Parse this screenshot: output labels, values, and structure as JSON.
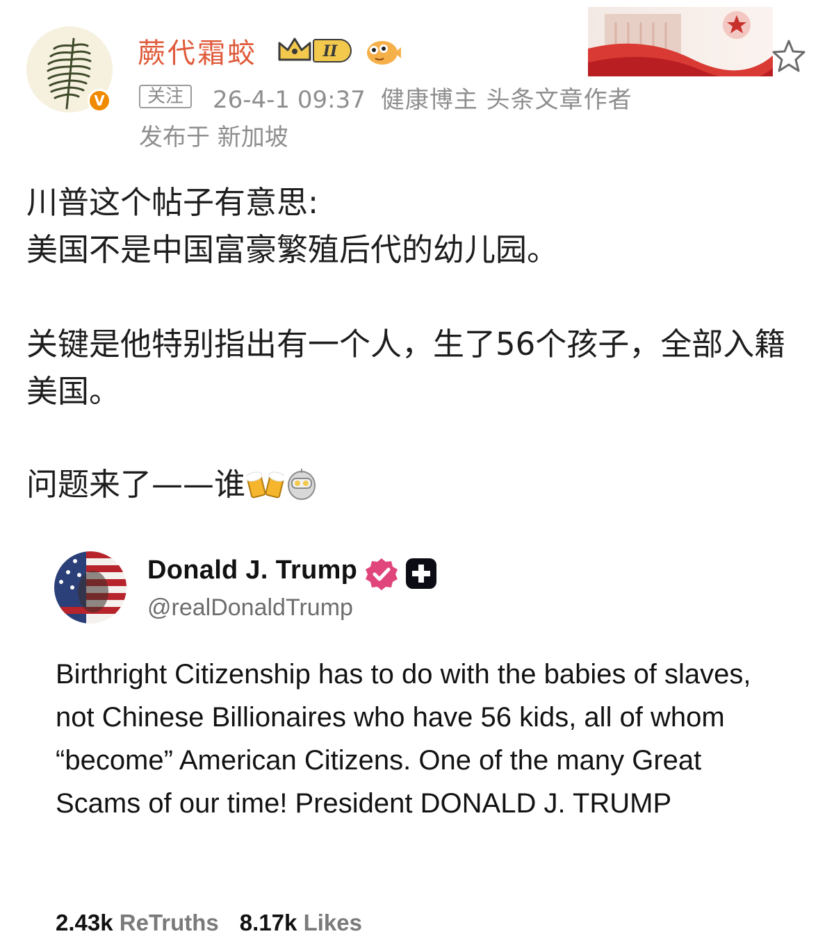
{
  "header": {
    "username": "蕨代霜蛟",
    "rank_badge": "II",
    "follow_label": "关注",
    "timestamp": "26-4-1 09:37",
    "tags": "健康博主 头条文章作者",
    "location": "发布于 新加坡",
    "verified_mark": "V",
    "icons": [
      "fern-avatar-icon",
      "crown-icon",
      "pufferfish-emoji-icon",
      "flag-banner-icon",
      "star-icon"
    ]
  },
  "post": {
    "line1": "川普这个帖子有意思:",
    "line2": "美国不是中国富豪繁殖后代的幼儿园。",
    "paragraph2": "关键是他特别指出有一个人，生了56个孩子，全部入籍美国。",
    "paragraph3": "问题来了——谁",
    "emojis": [
      "beer-cheers-icon",
      "robot-icon"
    ]
  },
  "truth_card": {
    "name": "Donald J. Trump",
    "handle": "@realDonaldTrump",
    "body": "Birthright Citizenship has to do with the babies of slaves, not Chinese Billionaires who have 56 kids, all of whom “become” American Citizens. One of the many Great Scams of our time! President DONALD J. TRUMP",
    "retruths_count": "2.43k",
    "retruths_label": "ReTruths",
    "likes_count": "8.17k",
    "likes_label": "Likes"
  },
  "colors": {
    "username": "#e05a3a",
    "meta_gray": "#8e8e8e",
    "verified_orange": "#f08a00",
    "truth_verified": "#e0467c"
  }
}
